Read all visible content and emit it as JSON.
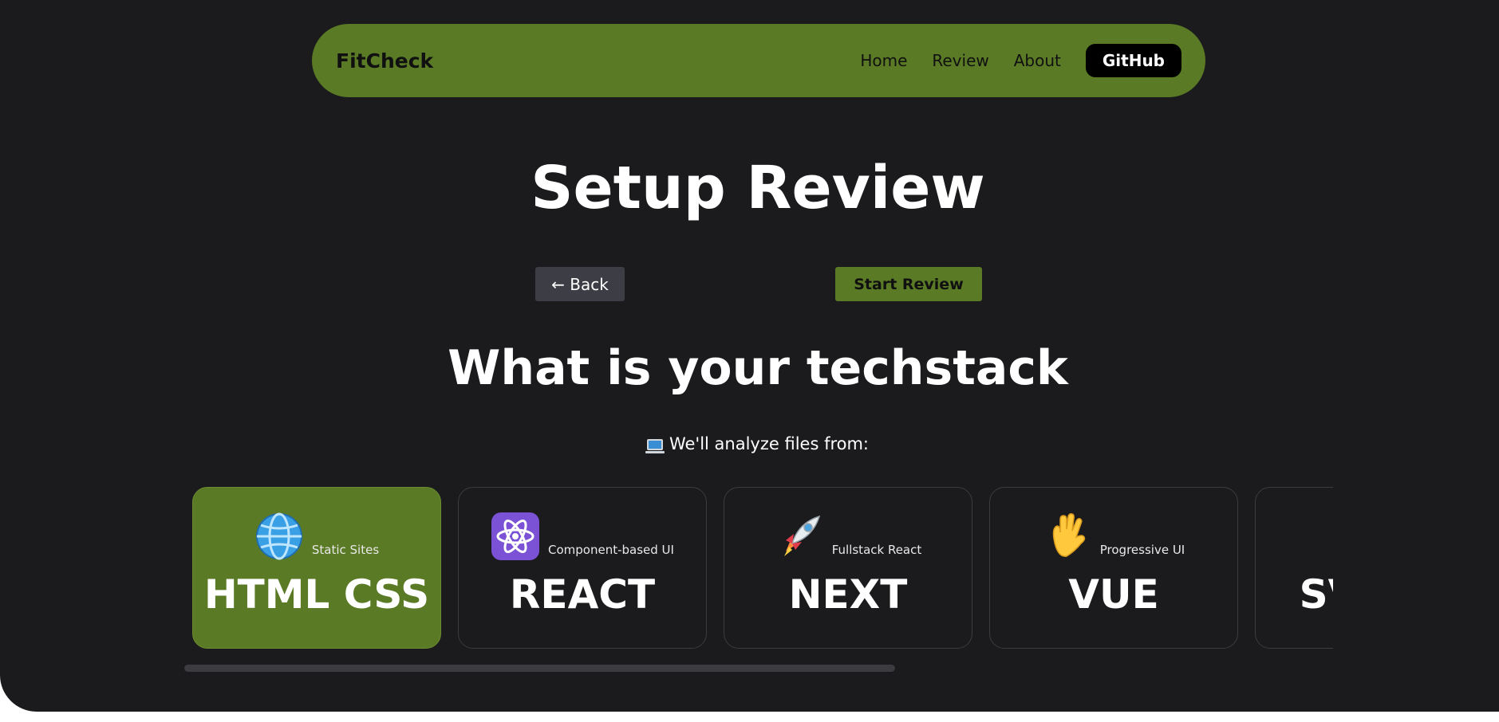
{
  "nav": {
    "brand": "FitCheck",
    "links": [
      "Home",
      "Review",
      "About"
    ],
    "github_label": "GitHub"
  },
  "page": {
    "title": "Setup Review",
    "back_label": "← Back",
    "start_label": "Start Review",
    "question": "What is your techstack",
    "analyze_note": "We'll analyze files from:",
    "analyze_icon": "laptop-icon"
  },
  "stacks": [
    {
      "name": "HTML CSS",
      "subtitle": "Static Sites",
      "icon": "globe-icon",
      "selected": true
    },
    {
      "name": "REACT",
      "subtitle": "Component-based UI",
      "icon": "atom-icon",
      "selected": false
    },
    {
      "name": "NEXT",
      "subtitle": "Fullstack React",
      "icon": "rocket-icon",
      "selected": false
    },
    {
      "name": "VUE",
      "subtitle": "Progressive UI",
      "icon": "waving-hand-icon",
      "selected": false
    },
    {
      "name": "SVELTE",
      "subtitle": "",
      "icon": "flame-icon",
      "selected": false
    }
  ],
  "colors": {
    "background": "#1b1b1d",
    "accent": "#5a7a25",
    "card_border": "#3b3b40",
    "secondary_button": "#3d3d45"
  }
}
